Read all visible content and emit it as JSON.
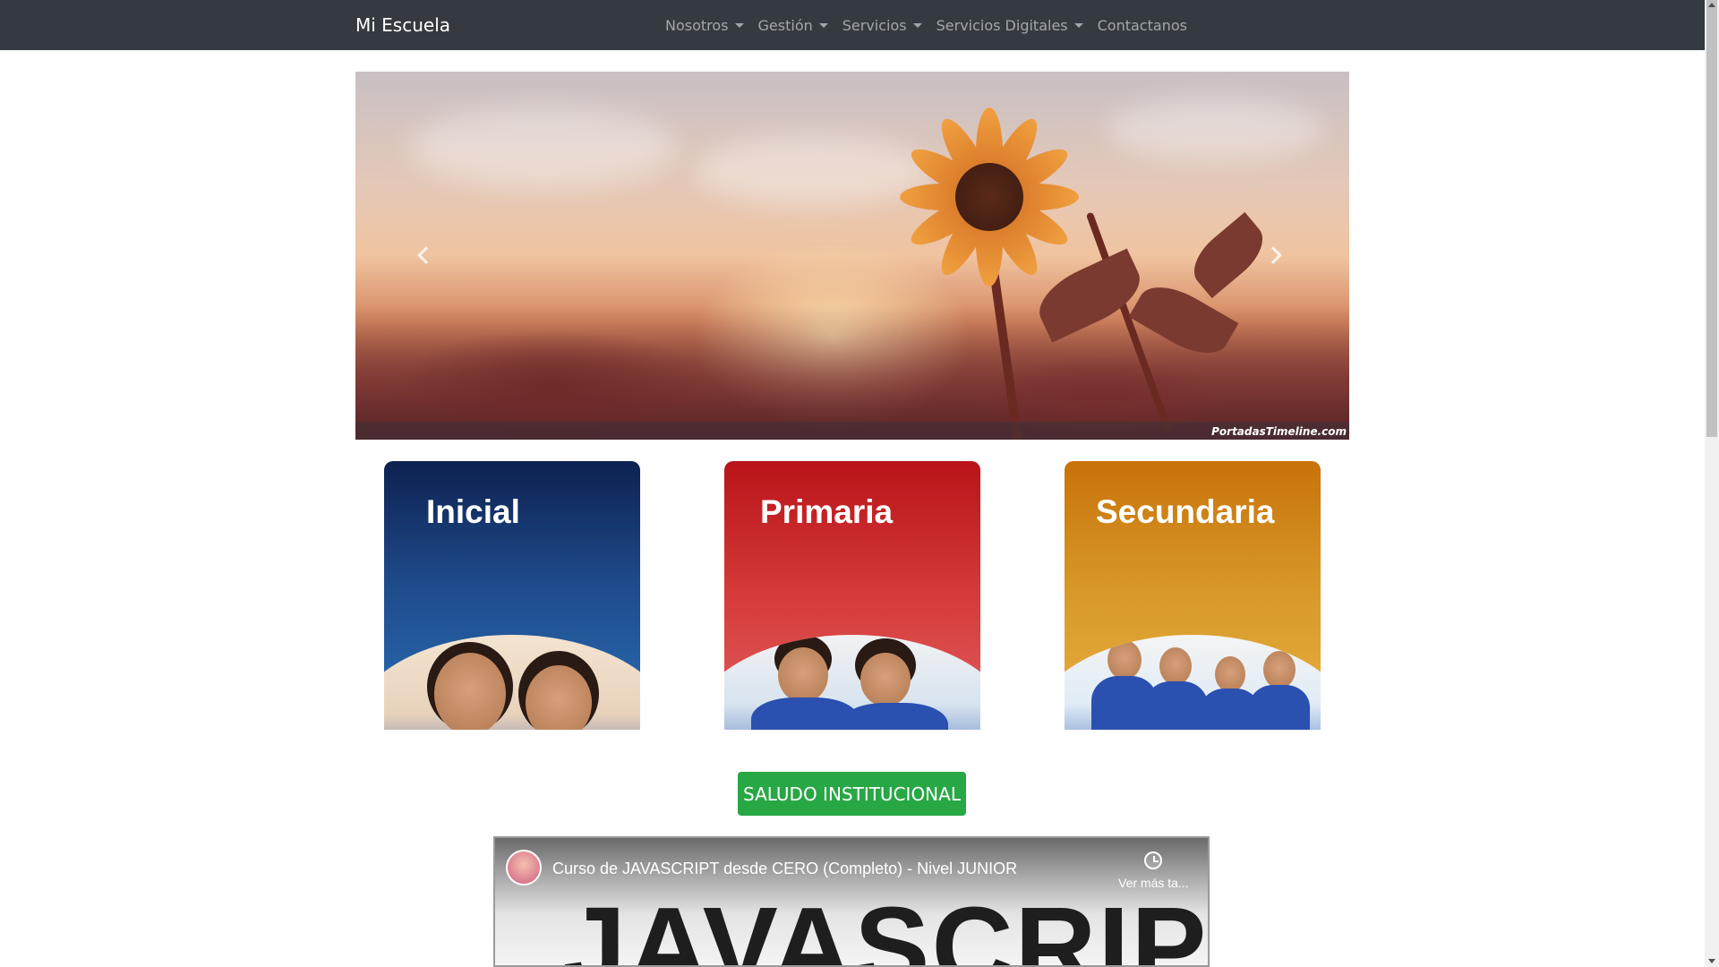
{
  "navbar": {
    "brand": "Mi Escuela",
    "items": [
      {
        "label": "Nosotros",
        "dropdown": true
      },
      {
        "label": "Gestión",
        "dropdown": true
      },
      {
        "label": "Servicios",
        "dropdown": true
      },
      {
        "label": "Servicios Digitales",
        "dropdown": true
      },
      {
        "label": "Contactanos",
        "dropdown": false
      }
    ],
    "background": "#343a40"
  },
  "carousel": {
    "watermark": "PortadasTimeline.com",
    "prev_icon": "chevron-left-icon",
    "next_icon": "chevron-right-icon"
  },
  "levels": [
    {
      "title": "Inicial",
      "color": "#1e4a8a"
    },
    {
      "title": "Primaria",
      "color": "#c8201f"
    },
    {
      "title": "Secundaria",
      "color": "#d8921f"
    }
  ],
  "saludo_button": {
    "label": "SALUDO INSTITUCIONAL",
    "color": "#28a745"
  },
  "video": {
    "title": "Curso de JAVASCRIPT desde CERO (Completo) - Nivel JUNIOR",
    "watch_later": "Ver más ta...",
    "thumbnail_text": "JAVASCRIPT"
  }
}
